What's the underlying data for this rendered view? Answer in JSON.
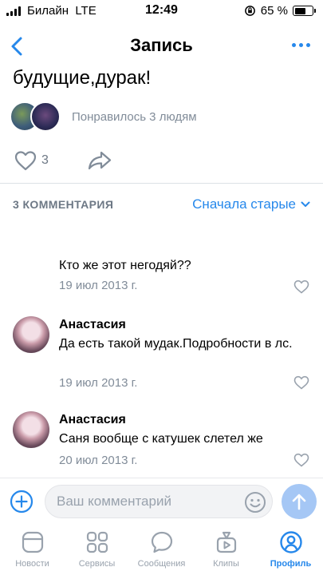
{
  "status_bar": {
    "carrier": "Билайн",
    "network": "LTE",
    "time": "12:49",
    "battery_text": "65 %",
    "battery_level": 0.65
  },
  "nav": {
    "title": "Запись",
    "back_icon": "chevron-left-icon",
    "more_icon": "more-horizontal-icon"
  },
  "post": {
    "text_tail": "будущие,дурак!",
    "liked_by": "Понравилось 3 людям",
    "like_count": "3"
  },
  "comments_section": {
    "count_label": "3 КОММЕНТАРИЯ",
    "sort_label": "Сначала старые"
  },
  "comments": [
    {
      "author": "",
      "text": "Кто же этот негодяй??",
      "date": "19 июл 2013 г."
    },
    {
      "author": "Анастасия",
      "text": "Да есть такой мудак.Подробности в лс.",
      "date": "19 июл 2013 г."
    },
    {
      "author": "Анастасия",
      "text": "Саня вообще с катушек слетел же",
      "date": "20 июл 2013 г."
    }
  ],
  "composer": {
    "placeholder": "Ваш комментарий"
  },
  "tabs": [
    {
      "label": "Новости",
      "icon": "news-icon"
    },
    {
      "label": "Сервисы",
      "icon": "services-icon"
    },
    {
      "label": "Сообщения",
      "icon": "messages-icon"
    },
    {
      "label": "Клипы",
      "icon": "clips-icon"
    },
    {
      "label": "Профиль",
      "icon": "profile-icon",
      "active": true
    }
  ],
  "colors": {
    "accent": "#2688eb",
    "secondary_text": "#818c99",
    "send_button": "#a5c7f5"
  }
}
